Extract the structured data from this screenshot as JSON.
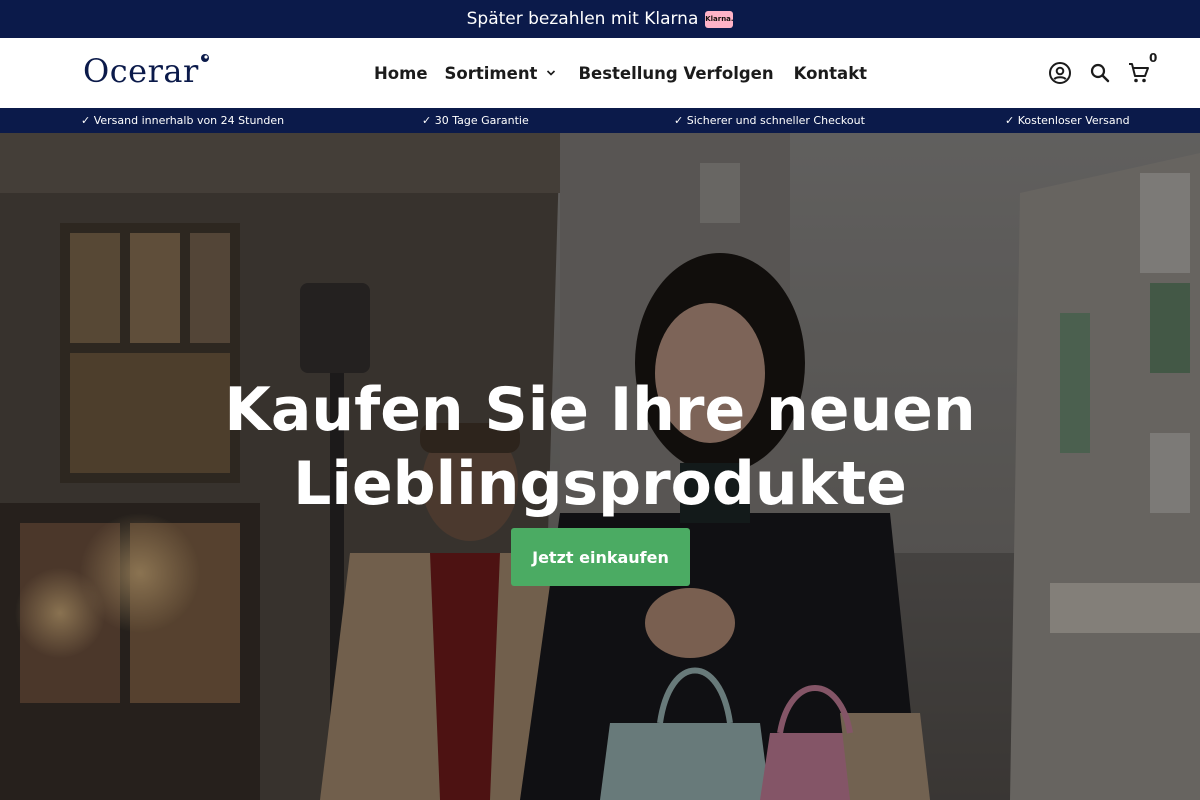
{
  "announcement": {
    "text": "Später bezahlen mit Klarna",
    "badge": "Klarna."
  },
  "header": {
    "logo": "Ocerar",
    "nav": [
      {
        "label": "Home"
      },
      {
        "label": "Sortiment",
        "has_dropdown": true
      },
      {
        "label": "Bestellung Verfolgen"
      },
      {
        "label": "Kontakt"
      }
    ],
    "icons": [
      "account-icon",
      "search-icon",
      "cart-icon"
    ],
    "cart_count": "0"
  },
  "usp": [
    "✓ Versand innerhalb von 24 Stunden",
    "✓ 30 Tage Garantie",
    "✓ Sicherer und schneller Checkout",
    "✓ Kostenloser Versand"
  ],
  "hero": {
    "title_line1": "Kaufen Sie Ihre neuen",
    "title_line2": "Lieblingsprodukte",
    "cta_label": "Jetzt einkaufen"
  },
  "colors": {
    "navy": "#0b1a4a",
    "cta_green": "#4bab63",
    "klarna_pink": "#ffb3c7"
  }
}
